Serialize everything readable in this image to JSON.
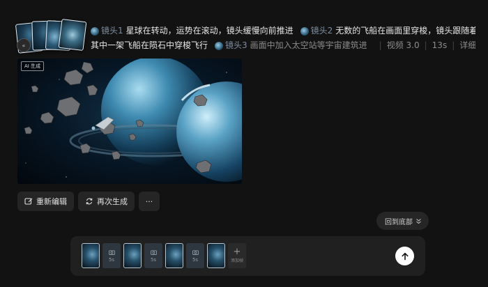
{
  "prompt": {
    "stack_badge": "«",
    "shots": [
      {
        "tag": "镜头1",
        "text": "星球在转动，运势在滚动，镜头缓慢向前推进"
      },
      {
        "tag": "镜头2",
        "text": "无数的飞船在画面里穿梭，镜头跟随着"
      },
      {
        "text_cont": "其中一架飞船在陨石中穿梭飞行"
      },
      {
        "tag": "镜头3",
        "text": "画面中加入太空站等宇宙建筑进"
      }
    ],
    "model": "视频 3.0",
    "duration": "13s",
    "details_label": "详细信息"
  },
  "image": {
    "ai_badge": "AI 生成"
  },
  "actions": {
    "reedit_label": "重新编辑",
    "regenerate_label": "再次生成",
    "more_label": "···"
  },
  "back_to_bottom": "回到底部",
  "composer": {
    "transitions": [
      "5s",
      "5s",
      "5s"
    ],
    "add_label": "添加帧"
  },
  "colors": {
    "background": "#121212",
    "button": "#252525",
    "composer": "#202020",
    "shot_tag": "#7f8da0"
  }
}
